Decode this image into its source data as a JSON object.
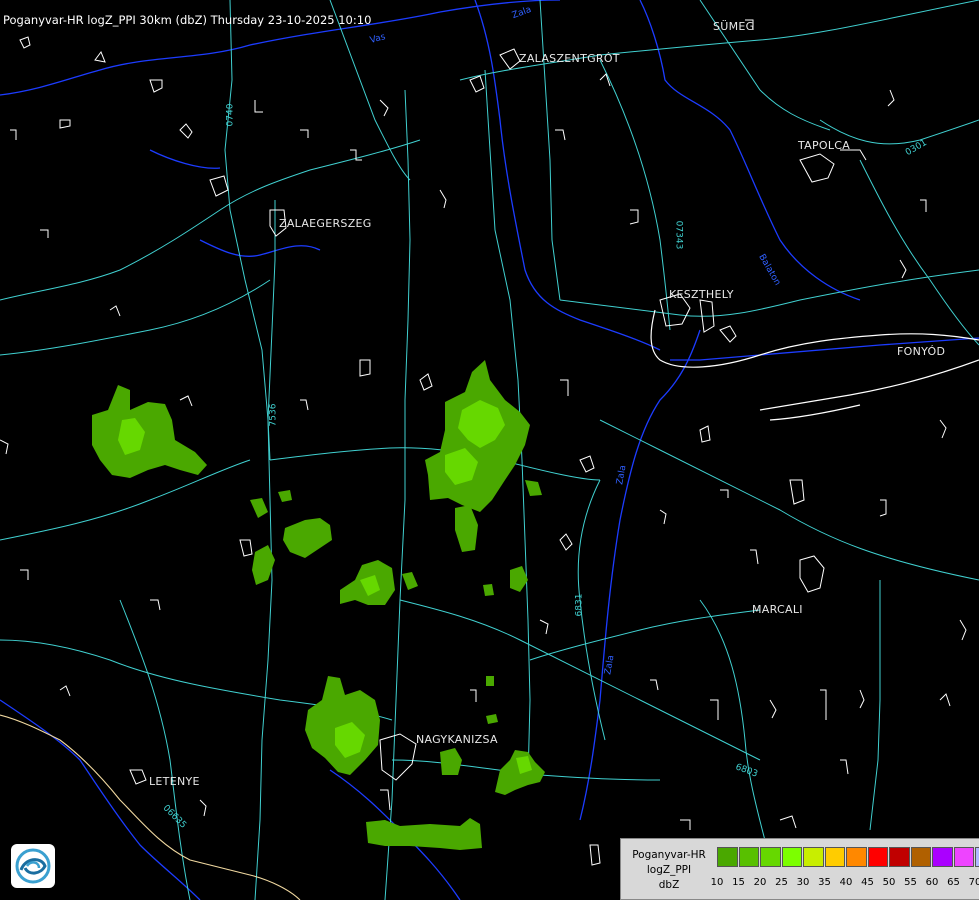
{
  "header": {
    "title": "Poganyvar-HR logZ_PPI 30km (dbZ) Thursday 23-10-2025 10:10"
  },
  "cities": [
    {
      "id": "sumeg",
      "name": "SÜMEG"
    },
    {
      "id": "zalaszentgrot",
      "name": "ZALASZENTGRÓT"
    },
    {
      "id": "tapolca",
      "name": "TAPOLCA"
    },
    {
      "id": "zalaegerszeg",
      "name": "ZALAEGERSZEG"
    },
    {
      "id": "keszthely",
      "name": "KESZTHELY"
    },
    {
      "id": "fonyod",
      "name": "FONYÓD"
    },
    {
      "id": "marcali",
      "name": "MARCALI"
    },
    {
      "id": "nagykanizsa",
      "name": "NAGYKANIZSA"
    },
    {
      "id": "letenye",
      "name": "LETENYE"
    }
  ],
  "road_labels": [
    "0740",
    "07343",
    "0301",
    "7536",
    "6831",
    "6803",
    "06635"
  ],
  "river_labels": [
    "Zala",
    "Vas",
    "Zala",
    "Balaton",
    "Zala"
  ],
  "legend": {
    "title_lines": [
      "Poganyvar-HR",
      "logZ_PPI",
      "dbZ"
    ],
    "colors": [
      "#4aa800",
      "#58c000",
      "#66d800",
      "#7cff00",
      "#c8ee00",
      "#ffcc00",
      "#ff8800",
      "#ff0000",
      "#c00000",
      "#b06000",
      "#aa00ff",
      "#ee44ff",
      "#b0b8ff"
    ],
    "ticks": [
      "10",
      "15",
      "20",
      "25",
      "30",
      "35",
      "40",
      "45",
      "50",
      "55",
      "60",
      "65",
      "70"
    ]
  },
  "colors": {
    "background": "#000000",
    "roads": "#40d0d0",
    "rivers": "#1c3cff",
    "settlements": "#ffffff",
    "echo_weak": "#4aa800",
    "echo_mid": "#66d800"
  },
  "logo": {
    "icon": "weather-service-logo-icon"
  }
}
